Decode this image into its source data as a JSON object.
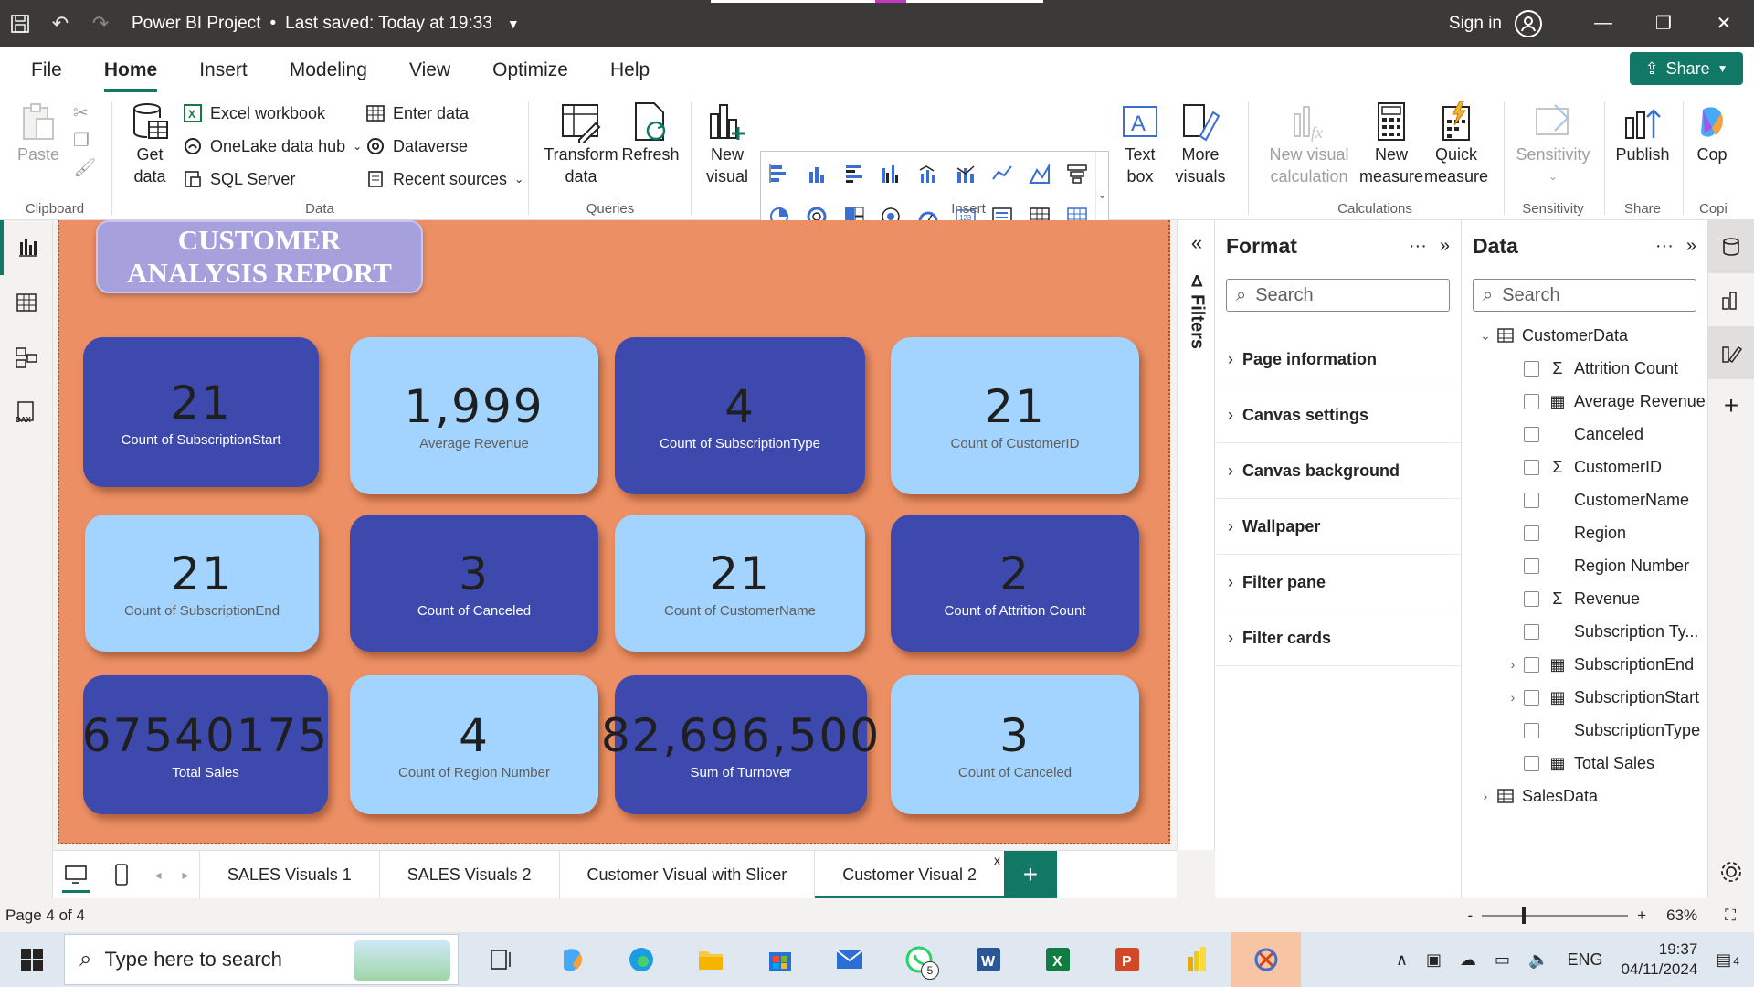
{
  "titlebar": {
    "title": "Power BI Project",
    "saved": "Last saved: Today at 19:33",
    "sign_in": "Sign in"
  },
  "menu": [
    "File",
    "Home",
    "Insert",
    "Modeling",
    "View",
    "Optimize",
    "Help"
  ],
  "share": "Share",
  "ribbon": {
    "paste": "Paste",
    "clipboard": "Clipboard",
    "get_data": "Get data",
    "excel": "Excel workbook",
    "onelake": "OneLake data hub",
    "sql": "SQL Server",
    "enter_data": "Enter data",
    "dataverse": "Dataverse",
    "recent": "Recent sources",
    "data_group": "Data",
    "transform": "Transform data",
    "refresh": "Refresh",
    "queries": "Queries",
    "new_visual": "New visual",
    "text_box": "Text box",
    "more_visuals": "More visuals",
    "insert_group": "Insert",
    "new_visual_calc": "New visual calculation",
    "new_measure": "New measure",
    "quick_measure": "Quick measure",
    "calculations": "Calculations",
    "sensitivity": "Sensitivity",
    "sensitivity_group": "Sensitivity",
    "publish": "Publish",
    "share_group": "Share",
    "copilot": "Cop",
    "copilot_group": "Copi"
  },
  "report": {
    "title_line1": "CUSTOMER",
    "title_line2": "ANALYSIS REPORT",
    "cards": [
      {
        "value": "21",
        "label": "Count of SubscriptionStart",
        "style": "dark"
      },
      {
        "value": "1,999",
        "label": "Average Revenue",
        "style": "light"
      },
      {
        "value": "4",
        "label": "Count of SubscriptionType",
        "style": "dark"
      },
      {
        "value": "21",
        "label": "Count of CustomerID",
        "style": "light"
      },
      {
        "value": "21",
        "label": "Count of SubscriptionEnd",
        "style": "light"
      },
      {
        "value": "3",
        "label": "Count of Canceled",
        "style": "dark"
      },
      {
        "value": "21",
        "label": "Count of CustomerName",
        "style": "light"
      },
      {
        "value": "2",
        "label": "Count of Attrition Count",
        "style": "dark"
      },
      {
        "value": "67540175",
        "label": "Total Sales",
        "style": "dark"
      },
      {
        "value": "4",
        "label": "Count of Region Number",
        "style": "light"
      },
      {
        "value": "82,696,500",
        "label": "Sum of Turnover",
        "style": "dark"
      },
      {
        "value": "3",
        "label": "Count of Canceled",
        "style": "light"
      }
    ]
  },
  "filters_label": "Filters",
  "format_pane": {
    "title": "Format",
    "search_placeholder": "Search",
    "items": [
      "Page information",
      "Canvas settings",
      "Canvas background",
      "Wallpaper",
      "Filter pane",
      "Filter cards"
    ]
  },
  "data_pane": {
    "title": "Data",
    "search_placeholder": "Search",
    "tables": [
      {
        "name": "CustomerData",
        "expanded": true,
        "fields": [
          {
            "name": "Attrition Count",
            "icon": "sigma"
          },
          {
            "name": "Average Revenue",
            "icon": "calc"
          },
          {
            "name": "Canceled",
            "icon": ""
          },
          {
            "name": "CustomerID",
            "icon": "sigma"
          },
          {
            "name": "CustomerName",
            "icon": ""
          },
          {
            "name": "Region",
            "icon": ""
          },
          {
            "name": "Region Number",
            "icon": ""
          },
          {
            "name": "Revenue",
            "icon": "sigma"
          },
          {
            "name": "Subscription Ty...",
            "icon": ""
          },
          {
            "name": "SubscriptionEnd",
            "icon": "date",
            "expandable": true
          },
          {
            "name": "SubscriptionStart",
            "icon": "date",
            "expandable": true
          },
          {
            "name": "SubscriptionType",
            "icon": ""
          },
          {
            "name": "Total Sales",
            "icon": "calc"
          }
        ]
      },
      {
        "name": "SalesData",
        "expanded": false,
        "fields": []
      }
    ]
  },
  "tabs": [
    "SALES Visuals 1",
    "SALES Visuals 2",
    "Customer Visual with Slicer",
    "Customer Visual 2"
  ],
  "active_tab": "Customer Visual 2",
  "status": {
    "page": "Page 4 of 4",
    "zoom": "63%"
  },
  "taskbar": {
    "search_placeholder": "Type here to search",
    "whatsapp_badge": "5",
    "lang": "ENG",
    "time": "19:37",
    "date": "04/11/2024",
    "notifications": "4"
  },
  "colors": {
    "accent": "#117865",
    "canvas": "#ec8f64",
    "card_dark": "#3d49ad",
    "card_light": "#a3d4ff",
    "title_box": "#a6a1dc"
  }
}
